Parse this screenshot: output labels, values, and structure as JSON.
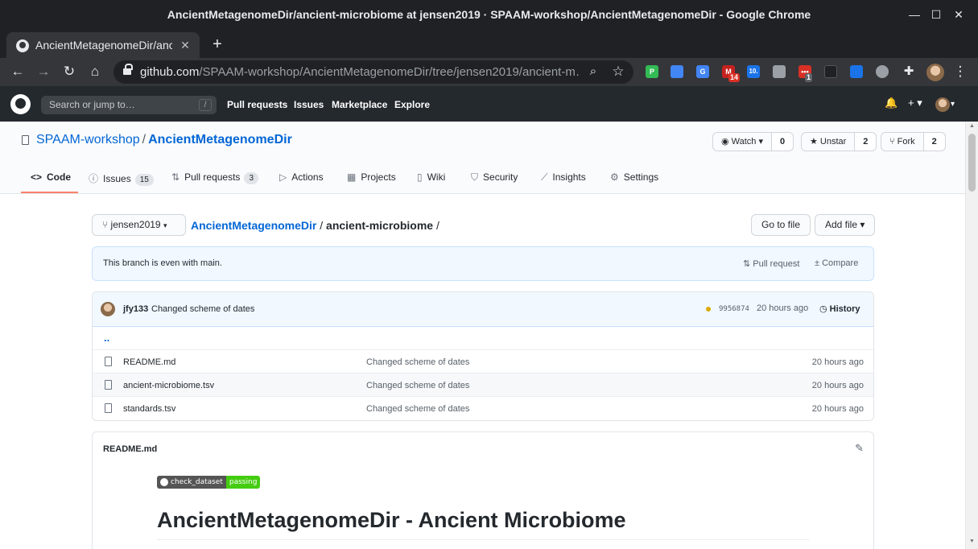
{
  "window": {
    "title": "AncientMetagenomeDir/ancient-microbiome at jensen2019 · SPAAM-workshop/AncientMetagenomeDir - Google Chrome",
    "minimize": "—",
    "maximize": "☐",
    "close": "✕"
  },
  "tab": {
    "title": "AncientMetagenomeDir/ancient-microbiome",
    "close": "✕",
    "new_tab": "+"
  },
  "toolbar": {
    "back": "←",
    "forward": "→",
    "reload": "↻",
    "home": "⌂",
    "url_host": "github.com",
    "url_path": "/SPAAM-workshop/AncientMetagenomeDir/tree/jensen2019/ancient-m…",
    "zoom_icon": "⌕",
    "star_icon": "☆",
    "ext_badge_1": "14",
    "ext_label_2": "10.",
    "ext_badge_3": "1",
    "puzzle_icon": "✚",
    "menu_icon": "⋮"
  },
  "gh_header": {
    "search_placeholder": "Search or jump to…",
    "search_key": "/",
    "nav": [
      "Pull requests",
      "Issues",
      "Marketplace",
      "Explore"
    ],
    "bell": "🔔",
    "plus": "+ ▾",
    "avatar_caret": "▾"
  },
  "repo": {
    "owner": "SPAAM-workshop",
    "separator": "/",
    "name": "AncientMetagenomeDir",
    "watch_label": "Watch ▾",
    "watch_count": "0",
    "star_label": "Unstar",
    "star_count": "2",
    "fork_label": "Fork",
    "fork_count": "2"
  },
  "reponav": {
    "code": "Code",
    "issues": "Issues",
    "issues_count": "15",
    "pulls": "Pull requests",
    "pulls_count": "3",
    "actions": "Actions",
    "projects": "Projects",
    "wiki": "Wiki",
    "security": "Security",
    "insights": "Insights",
    "settings": "Settings"
  },
  "browser": {
    "branch": "jensen2019",
    "crumb_root": "AncientMetagenomeDir",
    "crumb_sep": "/",
    "crumb_current": "ancient-microbiome",
    "crumb_trail": "/",
    "go_to_file": "Go to file",
    "add_file": "Add file ▾",
    "branch_status": "This branch is even with main.",
    "pull_request": "Pull request",
    "compare": "Compare"
  },
  "commit": {
    "author": "jfy133",
    "message": "Changed scheme of dates",
    "sha": "9956874",
    "when": "20 hours ago",
    "history": "History"
  },
  "files": {
    "up": "..",
    "rows": [
      {
        "name": "README.md",
        "message": "Changed scheme of dates",
        "age": "20 hours ago"
      },
      {
        "name": "ancient-microbiome.tsv",
        "message": "Changed scheme of dates",
        "age": "20 hours ago"
      },
      {
        "name": "standards.tsv",
        "message": "Changed scheme of dates",
        "age": "20 hours ago"
      }
    ]
  },
  "readme": {
    "title": "README.md",
    "badge_label": "check_dataset",
    "badge_status": "passing",
    "heading": "AncientMetagenomeDir - Ancient Microbiome"
  },
  "colors": {
    "gh_header": "#24292e",
    "link": "#0366d6",
    "active_tab_underline": "#f9826c",
    "badge_pass": "#44cc11"
  }
}
